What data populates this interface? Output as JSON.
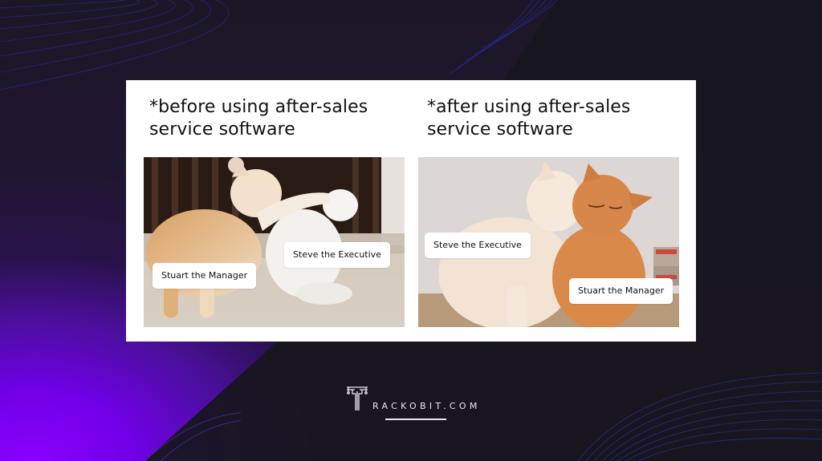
{
  "panels": [
    {
      "caption_line1": "*before using after-sales",
      "caption_line2": "service software",
      "photo": "two-cats-fighting",
      "labels": [
        "Stuart the Manager",
        "Steve the Executive"
      ]
    },
    {
      "caption_line1": "*after using after-sales",
      "caption_line2": "service software",
      "photo": "two-cats-cuddling",
      "labels": [
        "Steve the Executive",
        "Stuart the Manager"
      ]
    }
  ],
  "brand": {
    "logo_icon": "trackobit-circuit-t-icon",
    "text": "RACKOBIT.COM"
  },
  "colors": {
    "background_dark": "#17161c",
    "accent_purple": "#8a00ff",
    "wave_blue": "#2b2ab8",
    "card": "#ffffff",
    "text": "#111111"
  }
}
